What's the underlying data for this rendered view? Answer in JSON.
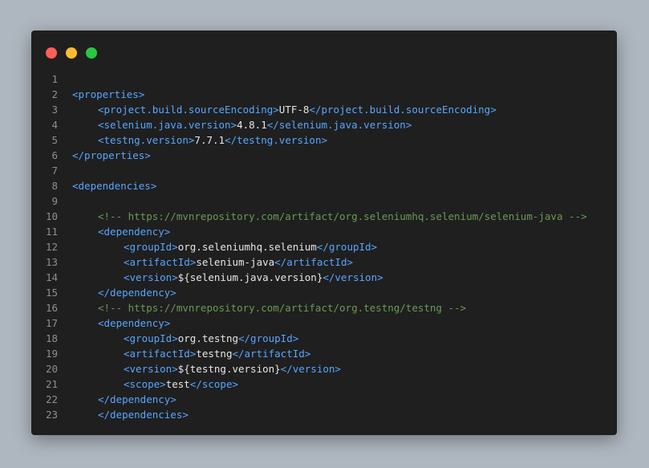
{
  "editor": {
    "window_controls": [
      {
        "name": "close",
        "color": "#ff5f57"
      },
      {
        "name": "minimize",
        "color": "#febc2e"
      },
      {
        "name": "maximize",
        "color": "#28c840"
      }
    ],
    "colors": {
      "background": "#1f1f1f",
      "tag": "#58a6ff",
      "text": "#e6e6e6",
      "comment": "#6a9955",
      "line_number": "#8f8f8f"
    },
    "lines": [
      {
        "n": "1",
        "indent": 0,
        "parts": []
      },
      {
        "n": "2",
        "indent": 0,
        "parts": [
          {
            "t": "tag",
            "v": "<properties>"
          }
        ]
      },
      {
        "n": "3",
        "indent": 1,
        "parts": [
          {
            "t": "tag",
            "v": "<project.build.sourceEncoding>"
          },
          {
            "t": "text",
            "v": "UTF-8"
          },
          {
            "t": "tag",
            "v": "</project.build.sourceEncoding>"
          }
        ]
      },
      {
        "n": "4",
        "indent": 1,
        "parts": [
          {
            "t": "tag",
            "v": "<selenium.java.version>"
          },
          {
            "t": "text",
            "v": "4.8.1"
          },
          {
            "t": "tag",
            "v": "</selenium.java.version>"
          }
        ]
      },
      {
        "n": "5",
        "indent": 1,
        "parts": [
          {
            "t": "tag",
            "v": "<testng.version>"
          },
          {
            "t": "text",
            "v": "7.7.1"
          },
          {
            "t": "tag",
            "v": "</testng.version>"
          }
        ]
      },
      {
        "n": "6",
        "indent": 0,
        "parts": [
          {
            "t": "tag",
            "v": "</properties>"
          }
        ]
      },
      {
        "n": "7",
        "indent": 0,
        "parts": []
      },
      {
        "n": "8",
        "indent": 0,
        "parts": [
          {
            "t": "tag",
            "v": "<dependencies>"
          }
        ]
      },
      {
        "n": "9",
        "indent": 0,
        "parts": []
      },
      {
        "n": "10",
        "indent": 1,
        "parts": [
          {
            "t": "comment",
            "v": "<!-- https://mvnrepository.com/artifact/org.seleniumhq.selenium/selenium-java -->"
          }
        ]
      },
      {
        "n": "11",
        "indent": 1,
        "parts": [
          {
            "t": "tag",
            "v": "<dependency>"
          }
        ]
      },
      {
        "n": "12",
        "indent": 2,
        "parts": [
          {
            "t": "tag",
            "v": "<groupId>"
          },
          {
            "t": "text",
            "v": "org.seleniumhq.selenium"
          },
          {
            "t": "tag",
            "v": "</groupId>"
          }
        ]
      },
      {
        "n": "13",
        "indent": 2,
        "parts": [
          {
            "t": "tag",
            "v": "<artifactId>"
          },
          {
            "t": "text",
            "v": "selenium-java"
          },
          {
            "t": "tag",
            "v": "</artifactId>"
          }
        ]
      },
      {
        "n": "14",
        "indent": 2,
        "parts": [
          {
            "t": "tag",
            "v": "<version>"
          },
          {
            "t": "text",
            "v": "${selenium.java.version}"
          },
          {
            "t": "tag",
            "v": "</version>"
          }
        ]
      },
      {
        "n": "15",
        "indent": 1,
        "parts": [
          {
            "t": "tag",
            "v": "</dependency>"
          }
        ]
      },
      {
        "n": "16",
        "indent": 1,
        "parts": [
          {
            "t": "comment",
            "v": "<!-- https://mvnrepository.com/artifact/org.testng/testng -->"
          }
        ]
      },
      {
        "n": "17",
        "indent": 1,
        "parts": [
          {
            "t": "tag",
            "v": "<dependency>"
          }
        ]
      },
      {
        "n": "18",
        "indent": 2,
        "parts": [
          {
            "t": "tag",
            "v": "<groupId>"
          },
          {
            "t": "text",
            "v": "org.testng"
          },
          {
            "t": "tag",
            "v": "</groupId>"
          }
        ]
      },
      {
        "n": "19",
        "indent": 2,
        "parts": [
          {
            "t": "tag",
            "v": "<artifactId>"
          },
          {
            "t": "text",
            "v": "testng"
          },
          {
            "t": "tag",
            "v": "</artifactId>"
          }
        ]
      },
      {
        "n": "20",
        "indent": 2,
        "parts": [
          {
            "t": "tag",
            "v": "<version>"
          },
          {
            "t": "text",
            "v": "${testng.version}"
          },
          {
            "t": "tag",
            "v": "</version>"
          }
        ]
      },
      {
        "n": "21",
        "indent": 2,
        "parts": [
          {
            "t": "tag",
            "v": "<scope>"
          },
          {
            "t": "text",
            "v": "test"
          },
          {
            "t": "tag",
            "v": "</scope>"
          }
        ]
      },
      {
        "n": "22",
        "indent": 1,
        "parts": [
          {
            "t": "tag",
            "v": "</dependency>"
          }
        ]
      },
      {
        "n": "23",
        "indent": 1,
        "parts": [
          {
            "t": "tag",
            "v": "</dependencies>"
          }
        ]
      }
    ]
  }
}
